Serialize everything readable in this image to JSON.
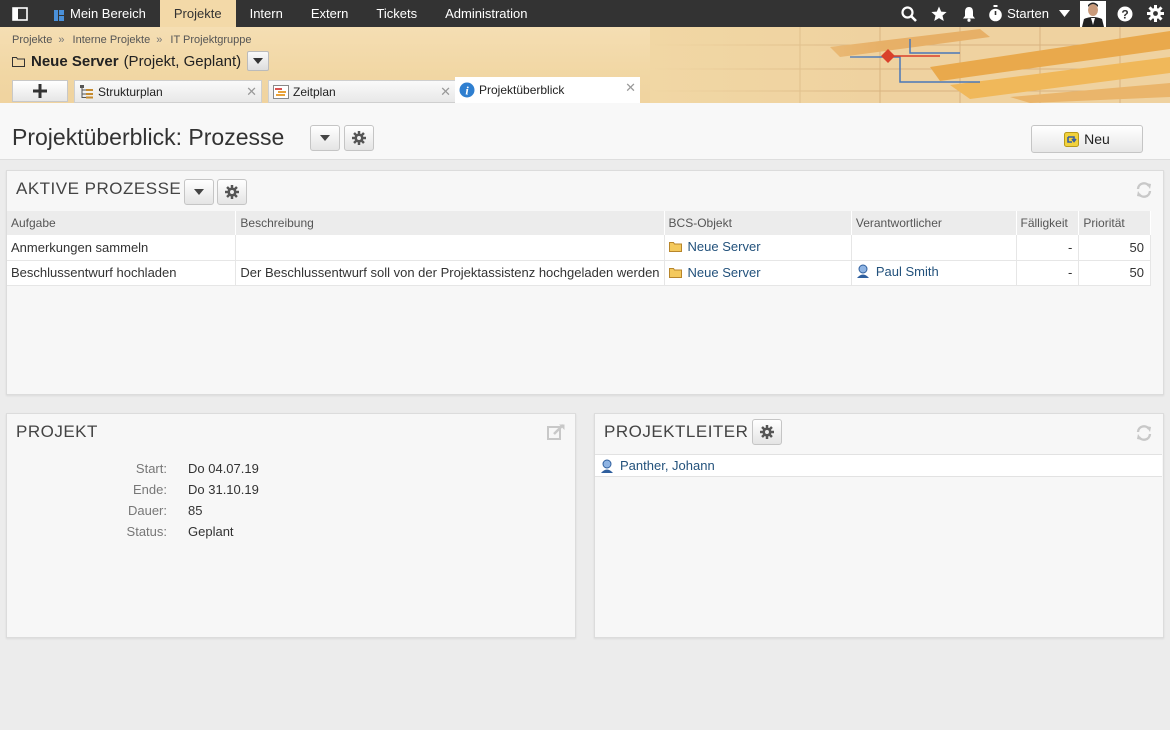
{
  "topnav": {
    "items": [
      {
        "label": "Mein Bereich"
      },
      {
        "label": "Projekte"
      },
      {
        "label": "Intern"
      },
      {
        "label": "Extern"
      },
      {
        "label": "Tickets"
      },
      {
        "label": "Administration"
      }
    ],
    "active_index": 1,
    "starten_label": "Starten"
  },
  "breadcrumb": [
    "Projekte",
    "Interne Projekte",
    "IT Projektgruppe"
  ],
  "breadcrumb_sep": "»",
  "project": {
    "name": "Neue Server",
    "meta": "(Projekt, Geplant)"
  },
  "tabs": [
    {
      "label": "Strukturplan",
      "icon": "structure-icon"
    },
    {
      "label": "Zeitplan",
      "icon": "gantt-icon"
    },
    {
      "label": "Projektüberblick",
      "icon": "info-icon"
    }
  ],
  "page": {
    "title": "Projektüberblick: Prozesse",
    "new_label": "Neu"
  },
  "aktive_prozesse": {
    "title": "AKTIVE PROZESSE",
    "columns": [
      "Aufgabe",
      "Beschreibung",
      "BCS-Objekt",
      "Verantwortlicher",
      "Fälligkeit",
      "Priorität"
    ],
    "rows": [
      {
        "aufgabe": "Anmerkungen sammeln",
        "beschreibung": "",
        "objekt": "Neue Server",
        "verantwortlicher": "",
        "faelligkeit": "-",
        "prioritaet": "50"
      },
      {
        "aufgabe": "Beschlussentwurf hochladen",
        "beschreibung": "Der Beschlussentwurf soll von der Projektassistenz hochgeladen werden",
        "objekt": "Neue Server",
        "verantwortlicher": "Paul Smith",
        "faelligkeit": "-",
        "prioritaet": "50"
      }
    ]
  },
  "projekt": {
    "title": "PROJEKT",
    "fields": [
      {
        "label": "Start:",
        "value": "Do 04.07.19"
      },
      {
        "label": "Ende:",
        "value": "Do 31.10.19"
      },
      {
        "label": "Dauer:",
        "value": "85"
      },
      {
        "label": "Status:",
        "value": "Geplant"
      }
    ]
  },
  "projektleiter": {
    "title": "PROJEKTLEITER",
    "people": [
      "Panther, Johann"
    ]
  },
  "colors": {
    "topbar": "#333333",
    "header": "#f3d9a8",
    "link": "#23527c"
  }
}
